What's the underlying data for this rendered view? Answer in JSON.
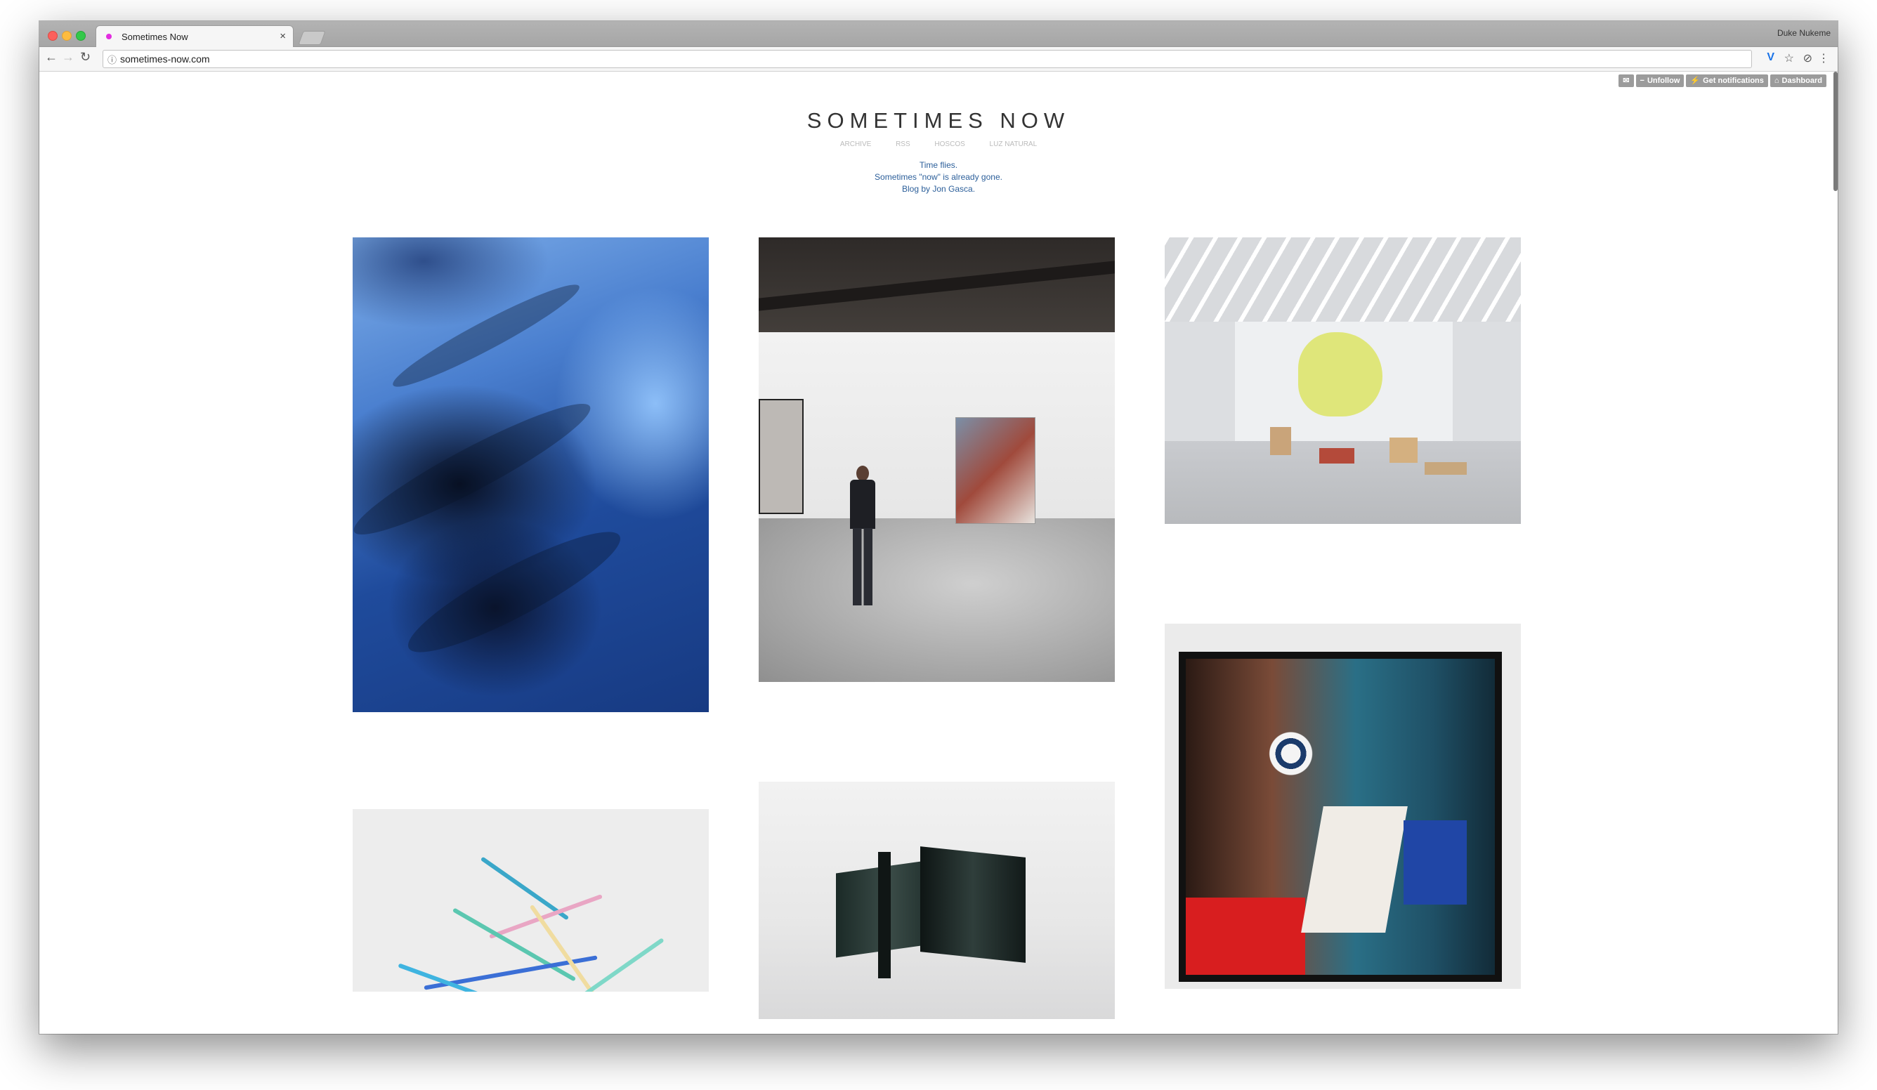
{
  "browser": {
    "tab_title": "Sometimes Now",
    "tab_close": "×",
    "profile_name": "Duke Nukeme",
    "url": "sometimes-now.com",
    "favicon_color": "#e32de0"
  },
  "tumblr_controls": {
    "unfollow": "Unfollow",
    "get_notifications": "Get notifications",
    "dashboard": "Dashboard"
  },
  "site": {
    "title": "SOMETIMES NOW",
    "nav": [
      "ARCHIVE",
      "RSS",
      "HOSCOS",
      "LUZ NATURAL"
    ],
    "description": [
      "Time flies.",
      "Sometimes \"now\" is already gone.",
      "Blog by Jon Gasca."
    ],
    "link_color": "#2c5f9a"
  },
  "posts": [
    {
      "image": "blue-abstract-photograph"
    },
    {
      "image": "gallery-visitor-photograph"
    },
    {
      "image": "art-installation-photograph"
    },
    {
      "image": "expressionist-portrait-painting"
    },
    {
      "image": "colorful-lattice-sculpture"
    },
    {
      "image": "dark-steel-sculpture"
    }
  ]
}
